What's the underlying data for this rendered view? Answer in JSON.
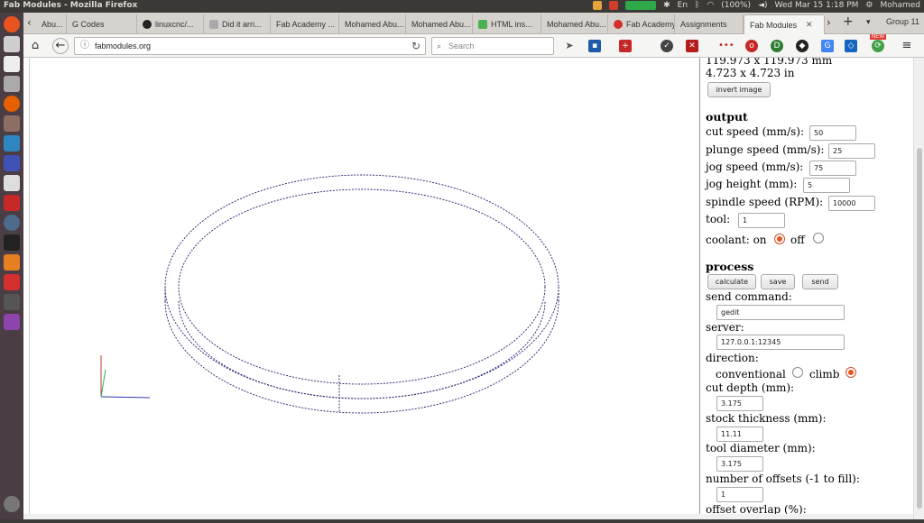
{
  "system": {
    "window_title": "Fab Modules - Mozilla Firefox",
    "battery": "(100%)",
    "datetime": "Wed Mar 15 1:18 PM",
    "user": "Mohamed",
    "lang": "En"
  },
  "tabs": [
    {
      "label": "Abu..."
    },
    {
      "label": "G Codes"
    },
    {
      "label": "linuxcnc/..."
    },
    {
      "label": "Did it arri..."
    },
    {
      "label": "Fab Academy ..."
    },
    {
      "label": "Mohamed Abu..."
    },
    {
      "label": "Mohamed Abu..."
    },
    {
      "label": "HTML ins..."
    },
    {
      "label": "Mohamed Abu..."
    },
    {
      "label": "Fab Academy ..."
    },
    {
      "label": "Assignments"
    },
    {
      "label": "Fab Modules",
      "active": true
    }
  ],
  "tab_group": "Group 11",
  "nav": {
    "url": "fabmodules.org",
    "search_placeholder": "Search",
    "new_badge": "NEW"
  },
  "panel": {
    "dims_mm": "119.973 x 119.973 mm",
    "dims_in": "4.723 x 4.723 in",
    "invert_label": "invert image",
    "output_heading": "output",
    "cut_speed_label": "cut speed (mm/s):",
    "cut_speed": "50",
    "plunge_speed_label": "plunge speed (mm/s):",
    "plunge_speed": "25",
    "jog_speed_label": "jog speed (mm/s):",
    "jog_speed": "75",
    "jog_height_label": "jog height (mm):",
    "jog_height": "5",
    "spindle_label": "spindle speed (RPM):",
    "spindle": "10000",
    "tool_label": "tool:",
    "tool": "1",
    "coolant_label": "coolant: on",
    "coolant_off_label": "off",
    "process_heading": "process",
    "calculate_label": "calculate",
    "save_label": "save",
    "send_label": "send",
    "send_command_label": "send command:",
    "send_command": "gedit",
    "server_label": "server:",
    "server": "127.0.0.1:12345",
    "direction_label": "direction:",
    "conventional_label": "conventional",
    "climb_label": "climb",
    "cut_depth_label": "cut depth (mm):",
    "cut_depth": "3.175",
    "stock_label": "stock thickness (mm):",
    "stock": "11.11",
    "tool_diameter_label": "tool diameter (mm):",
    "tool_diameter": "3.175",
    "offsets_label": "number of offsets (-1 to fill):",
    "offsets": "1",
    "overlap_label": "offset overlap (%):"
  },
  "colors": {
    "accent": "#e95420",
    "toolpath": "#1f1f6e",
    "launcher": "#4a3d44"
  }
}
